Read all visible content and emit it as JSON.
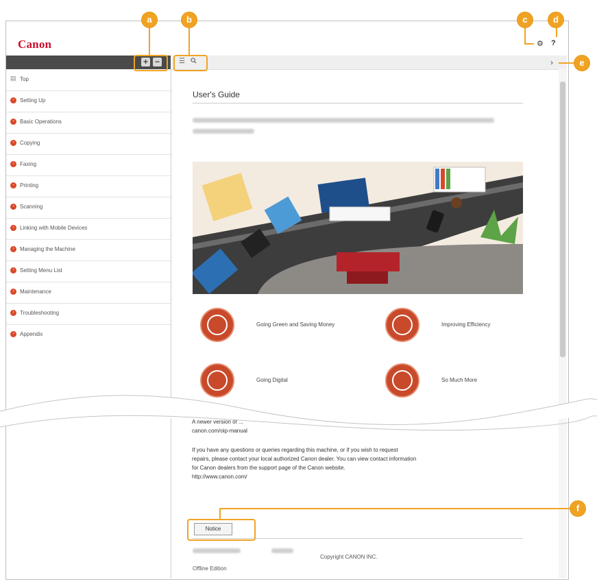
{
  "brand": {
    "logo_text": "Canon",
    "color": "#c8102e"
  },
  "header_icons": {
    "settings": "gear-icon",
    "help_glyph": "?"
  },
  "sidebar": {
    "expand_glyph": "+",
    "collapse_glyph": "−",
    "items": [
      {
        "label": "Top",
        "icon": "doc-icon"
      },
      {
        "label": "Setting Up",
        "icon": "arrow-bullet-icon"
      },
      {
        "label": "Basic Operations",
        "icon": "arrow-bullet-icon"
      },
      {
        "label": "Copying",
        "icon": "arrow-bullet-icon"
      },
      {
        "label": "Faxing",
        "icon": "arrow-bullet-icon"
      },
      {
        "label": "Printing",
        "icon": "arrow-bullet-icon"
      },
      {
        "label": "Scanning",
        "icon": "arrow-bullet-icon"
      },
      {
        "label": "Linking with Mobile Devices",
        "icon": "arrow-bullet-icon"
      },
      {
        "label": "Managing the Machine",
        "icon": "arrow-bullet-icon"
      },
      {
        "label": "Setting Menu List",
        "icon": "arrow-bullet-icon"
      },
      {
        "label": "Maintenance",
        "icon": "arrow-bullet-icon"
      },
      {
        "label": "Troubleshooting",
        "icon": "arrow-bullet-icon"
      },
      {
        "label": "Appendix",
        "icon": "arrow-bullet-icon"
      }
    ]
  },
  "toolbar": {
    "menu_icon": "list-icon",
    "search_icon": "search-icon",
    "collapse_icon": "chevron-right-icon"
  },
  "main": {
    "title": "User's Guide",
    "categories": [
      {
        "label": "Going Green and Saving Money",
        "icon": "eco-icon"
      },
      {
        "label": "Improving Efficiency",
        "icon": "chart-icon"
      },
      {
        "label": "Going Digital",
        "icon": "monitor-icon"
      },
      {
        "label": "So Much More",
        "icon": "magnify-icon"
      }
    ],
    "newer_version_text": "A newer version of ...",
    "manual_url": "canon.com/oip-manual",
    "contact_paragraph": [
      "If you have any questions or queries regarding this machine, or if you wish to request",
      "repairs, please contact your local authorized Canon dealer. You can view contact information",
      "for Canon dealers from the support page of the Canon website.",
      "http://www.canon.com/"
    ],
    "notice_button": "Notice",
    "copyright": "Copyright CANON INC.",
    "edition": "Offline Edition"
  },
  "callouts": [
    "a",
    "b",
    "c",
    "d",
    "e",
    "f"
  ],
  "colors": {
    "callout": "#f0a323",
    "bullet": "#d9482b",
    "accent": "#c84a2a"
  }
}
